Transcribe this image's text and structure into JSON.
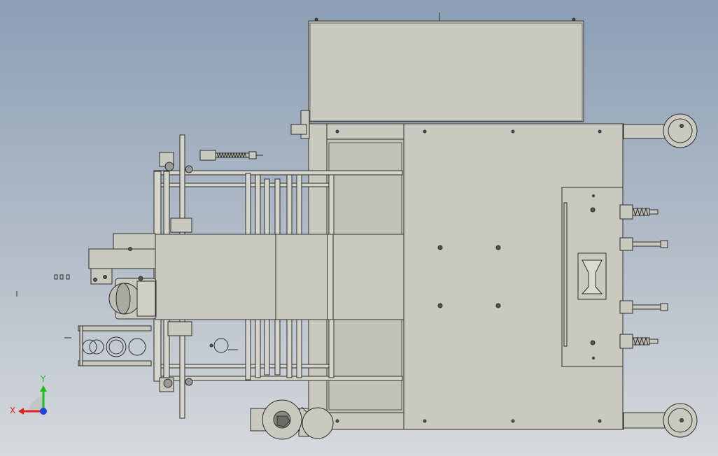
{
  "viewport": {
    "background_top": "#8c9fb6",
    "background_bottom": "#d6d9dd",
    "part_fill": "#c9c9bf",
    "part_stroke": "#2e2e2e"
  },
  "triad": {
    "x_label": "X",
    "y_label": "Y",
    "x_color": "#e02020",
    "y_color": "#18c020",
    "z_color": "#2040e0"
  }
}
